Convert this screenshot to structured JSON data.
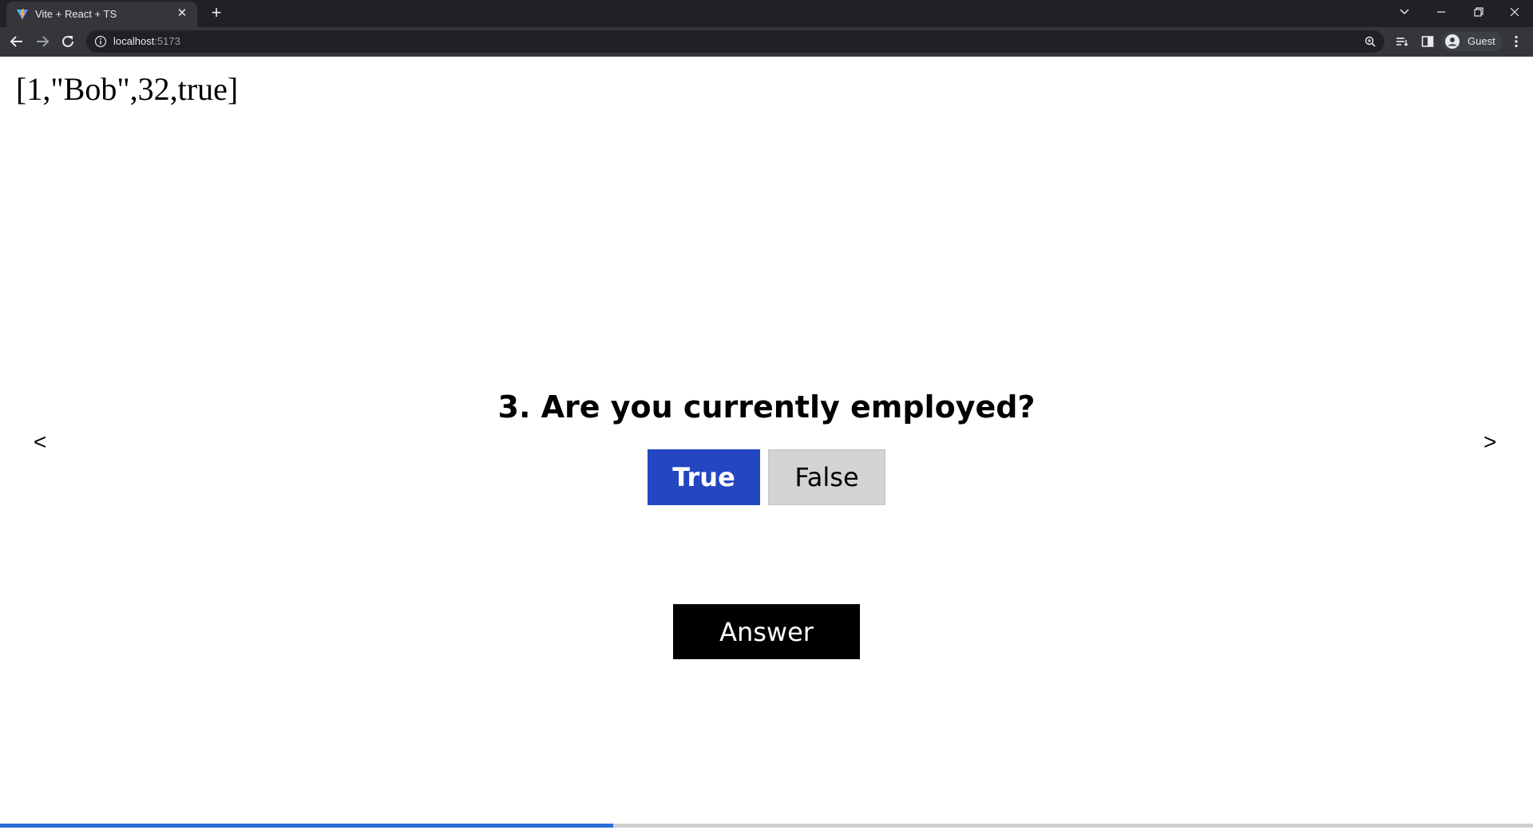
{
  "browser": {
    "tab_title": "Vite + React + TS",
    "url_host": "localhost",
    "url_port": ":5173",
    "profile_label": "Guest"
  },
  "page": {
    "state_dump": "[1,\"Bob\",32,true]",
    "prev_label": "<",
    "next_label": ">",
    "question": "3. Are you currently employed?",
    "choices": [
      {
        "label": "True",
        "selected": true
      },
      {
        "label": "False",
        "selected": false
      }
    ],
    "answer_label": "Answer",
    "progress": 0.4
  },
  "colors": {
    "selected_choice": "#2446c0",
    "unselected_choice": "#d3d3d3",
    "answer_button": "#000000",
    "progress_fill": "#2b6bd8",
    "progress_track": "#d0d0d0"
  },
  "icons": {
    "favicon": "vite-logo-icon",
    "tab_close": "close-icon",
    "new_tab": "plus-icon",
    "back": "arrow-left-icon",
    "forward": "arrow-right-icon",
    "reload": "reload-icon",
    "site_info": "info-icon",
    "zoom": "zoom-icon",
    "reading_list": "reading-list-icon",
    "side_panel": "side-panel-icon",
    "profile": "avatar-icon",
    "menu": "kebab-menu-icon"
  }
}
